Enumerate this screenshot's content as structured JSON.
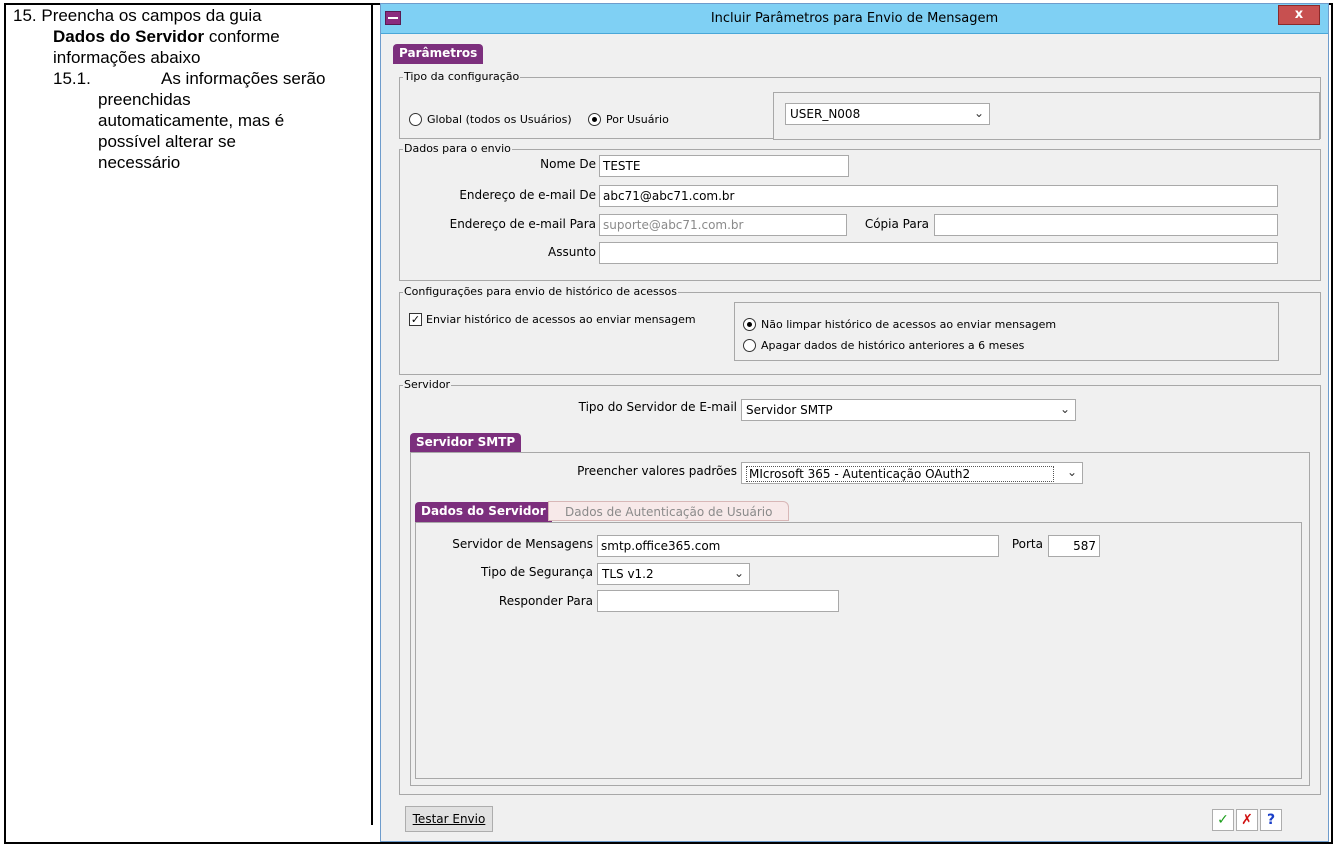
{
  "doc": {
    "step_prefix": "15. Preencha os campos da guia",
    "step_bold": "Dados do Servidor",
    "step_suffix": " conforme",
    "step_line3": "informações abaixo",
    "sub_num": "15.1.",
    "sub_line1": "As informações serão",
    "sub_line2": "preenchidas",
    "sub_line3": "automaticamente, mas é",
    "sub_line4": "possível alterar se",
    "sub_line5": "necessário"
  },
  "window": {
    "title": "Incluir Parâmetros para Envio de Mensagem",
    "close": "x"
  },
  "tabs": {
    "parametros": "Parâmetros"
  },
  "tipo_config": {
    "legend": "Tipo da configuração",
    "global_label": "Global (todos os Usuários)",
    "por_usuario_label": "Por Usuário",
    "user_value": "USER_N008"
  },
  "dados_envio": {
    "legend": "Dados para o envio",
    "nome_de_label": "Nome De",
    "nome_de_value": "TESTE",
    "email_de_label": "Endereço de e-mail De",
    "email_de_value": "abc71@abc71.com.br",
    "email_para_label": "Endereço de e-mail Para",
    "email_para_value": "suporte@abc71.com.br",
    "copia_para_label": "Cópia Para",
    "copia_para_value": "",
    "assunto_label": "Assunto",
    "assunto_value": ""
  },
  "historico": {
    "legend": "Configurações para envio de histórico de acessos",
    "enviar_label": "Enviar histórico de acessos ao enviar mensagem",
    "nao_limpar_label": "Não limpar histórico de acessos ao enviar mensagem",
    "apagar_label": "Apagar dados de histórico anteriores a 6 meses"
  },
  "servidor": {
    "legend": "Servidor",
    "tipo_label": "Tipo do Servidor de E-mail",
    "tipo_value": "Servidor SMTP",
    "smtp_tab": "Servidor SMTP",
    "preencher_label": "Preencher valores padrões",
    "preencher_value": "MIcrosoft 365 - Autenticação OAuth2"
  },
  "inner_tabs": {
    "dados_servidor": "Dados do Servidor",
    "dados_autenticacao": "Dados de Autenticação de Usuário"
  },
  "dados_servidor": {
    "servidor_label": "Servidor de Mensagens",
    "servidor_value": "smtp.office365.com",
    "porta_label": "Porta",
    "porta_value": "587",
    "seguranca_label": "Tipo de Segurança",
    "seguranca_value": "TLS v1.2",
    "responder_label": "Responder Para",
    "responder_value": ""
  },
  "footer": {
    "testar_envio": "Testar Envio",
    "ok": "✓",
    "cancel": "✗",
    "help": "?"
  },
  "colors": {
    "accent": "#7c2f7d",
    "titlebar": "#7fd0f4",
    "ok_green": "#1a9e1a",
    "cancel_red": "#d01010",
    "help_blue": "#1a3fc8"
  }
}
